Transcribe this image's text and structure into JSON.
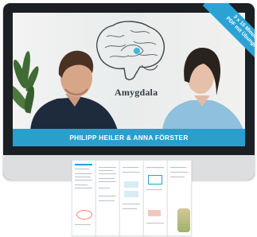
{
  "video": {
    "caption": "PHILIPP HEILER & ANNA FÖRSTER",
    "diagram_label": "Amygdala",
    "ribbon_line1": "3 x 15 Minuten",
    "ribbon_line2": "PDF mit Übungen"
  },
  "colors": {
    "accent": "#2b9fcc",
    "ribbon": "#2aa3d4",
    "monitor": "#1c1f23"
  }
}
